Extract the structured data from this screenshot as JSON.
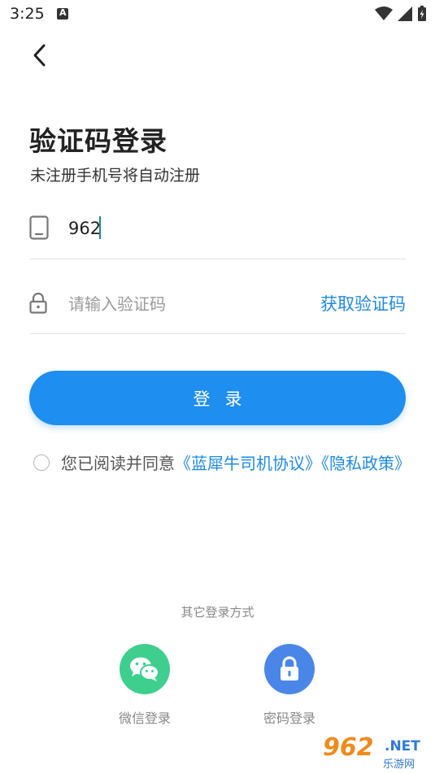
{
  "status_bar": {
    "time": "3:25"
  },
  "page": {
    "title": "验证码登录",
    "subtitle": "未注册手机号将自动注册"
  },
  "phone": {
    "value": "962"
  },
  "code": {
    "placeholder": "请输入验证码",
    "get_code_label": "获取验证码"
  },
  "login_button": {
    "label": "登录"
  },
  "agreement": {
    "prefix": "您已阅读并同意",
    "user_agreement": "《蓝犀牛司机协议》",
    "privacy_policy": "《隐私政策》"
  },
  "other_login": {
    "label": "其它登录方式",
    "wechat_label": "微信登录",
    "password_label": "密码登录"
  },
  "watermark": {
    "brand": "962",
    "net": ".NET",
    "sub": "乐游网"
  },
  "colors": {
    "accent": "#1e8ef0",
    "link": "#1e8ae6",
    "wechat": "#3ecf8e",
    "password": "#4a86e8"
  }
}
